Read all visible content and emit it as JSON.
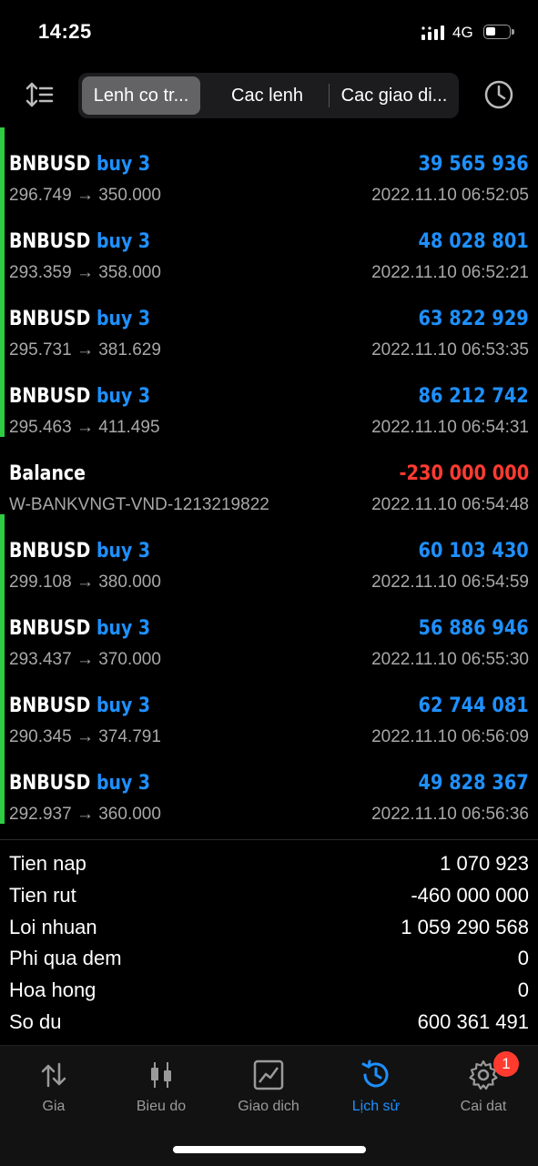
{
  "status_bar": {
    "time": "14:25",
    "network": "4G"
  },
  "header": {
    "tabs": [
      {
        "label": "Lenh co tr...",
        "active": true
      },
      {
        "label": "Cac lenh",
        "active": false
      },
      {
        "label": "Cac giao di...",
        "active": false
      }
    ],
    "icons": {
      "left": "sort-icon",
      "right": "history-clock-icon"
    }
  },
  "deals": [
    {
      "symbol": "BNBUSD",
      "side": "buy 3",
      "detail": "296.749 → 350.000",
      "amount": "39 565 936",
      "time": "2022.11.10 06:52:05",
      "type": "trade"
    },
    {
      "symbol": "BNBUSD",
      "side": "buy 3",
      "detail": "293.359 → 358.000",
      "amount": "48 028 801",
      "time": "2022.11.10 06:52:21",
      "type": "trade"
    },
    {
      "symbol": "BNBUSD",
      "side": "buy 3",
      "detail": "295.731 → 381.629",
      "amount": "63 822 929",
      "time": "2022.11.10 06:53:35",
      "type": "trade"
    },
    {
      "symbol": "BNBUSD",
      "side": "buy 3",
      "detail": "295.463 → 411.495",
      "amount": "86 212 742",
      "time": "2022.11.10 06:54:31",
      "type": "trade"
    },
    {
      "symbol": "Balance",
      "side": "",
      "detail": "W-BANKVNGT-VND-1213219822",
      "amount": "-230 000 000",
      "time": "2022.11.10 06:54:48",
      "type": "balance"
    },
    {
      "symbol": "BNBUSD",
      "side": "buy 3",
      "detail": "299.108 → 380.000",
      "amount": "60 103 430",
      "time": "2022.11.10 06:54:59",
      "type": "trade"
    },
    {
      "symbol": "BNBUSD",
      "side": "buy 3",
      "detail": "293.437 → 370.000",
      "amount": "56 886 946",
      "time": "2022.11.10 06:55:30",
      "type": "trade"
    },
    {
      "symbol": "BNBUSD",
      "side": "buy 3",
      "detail": "290.345 → 374.791",
      "amount": "62 744 081",
      "time": "2022.11.10 06:56:09",
      "type": "trade"
    },
    {
      "symbol": "BNBUSD",
      "side": "buy 3",
      "detail": "292.937 → 360.000",
      "amount": "49 828 367",
      "time": "2022.11.10 06:56:36",
      "type": "trade"
    }
  ],
  "summary": [
    {
      "label": "Tien nap",
      "value": "1 070 923"
    },
    {
      "label": "Tien rut",
      "value": "-460 000 000"
    },
    {
      "label": "Loi nhuan",
      "value": "1 059 290 568"
    },
    {
      "label": "Phi qua dem",
      "value": "0"
    },
    {
      "label": "Hoa hong",
      "value": "0"
    },
    {
      "label": "So du",
      "value": "600 361 491"
    }
  ],
  "tabbar": {
    "items": [
      {
        "label": "Gia",
        "icon": "quotes-arrows-icon",
        "active": false
      },
      {
        "label": "Bieu do",
        "icon": "candlestick-chart-icon",
        "active": false
      },
      {
        "label": "Giao dich",
        "icon": "trade-chart-icon",
        "active": false
      },
      {
        "label": "Lịch sử",
        "icon": "history-icon",
        "active": true
      },
      {
        "label": "Cai dat",
        "icon": "settings-gear-icon",
        "active": false
      }
    ],
    "badge": "1"
  },
  "colors": {
    "accent": "#1e90ff",
    "positive": "#1e90ff",
    "negative": "#ff3b30",
    "trade_marker": "#2ecc40"
  }
}
